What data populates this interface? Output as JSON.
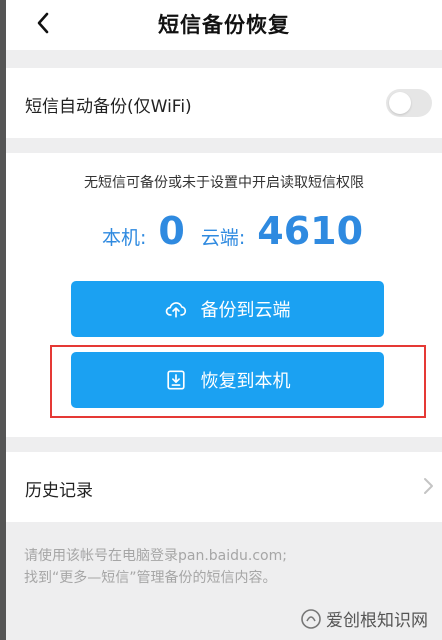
{
  "header": {
    "title": "短信备份恢复",
    "back_icon": "chevron-left-icon"
  },
  "auto_backup": {
    "label": "短信自动备份(仅WiFi)",
    "enabled": false
  },
  "main": {
    "hint": "无短信可备份或未于设置中开启读取短信权限",
    "local_label": "本机:",
    "local_count": "0",
    "cloud_label": "云端:",
    "cloud_count": "4610",
    "backup_button": "备份到云端",
    "backup_icon": "cloud-upload-icon",
    "restore_button": "恢复到本机",
    "restore_icon": "download-icon"
  },
  "history": {
    "label": "历史记录"
  },
  "footer": {
    "line1": "请使用该帐号在电脑登录pan.baidu.com;",
    "line2": "找到“更多—短信”管理备份的短信内容。"
  },
  "watermark": {
    "text": "爱创根知识网"
  },
  "colors": {
    "accent": "#1ba1f2",
    "count_blue": "#2f8ae0",
    "highlight_red": "#e53935",
    "background": "#eeeeef"
  }
}
